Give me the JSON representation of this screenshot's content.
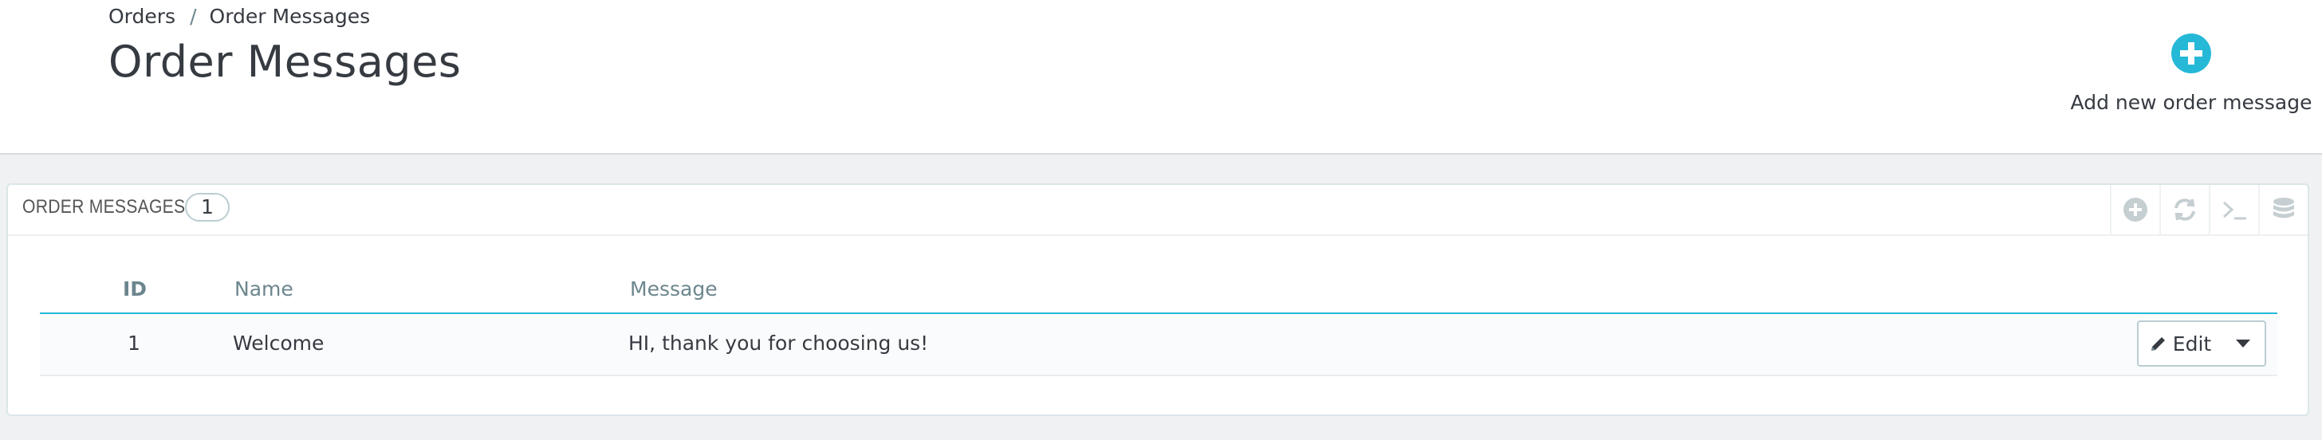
{
  "breadcrumb": {
    "parent": "Orders",
    "separator": "/",
    "current": "Order Messages"
  },
  "page": {
    "title": "Order Messages"
  },
  "toolbar": {
    "add_new_label": "Add new order message"
  },
  "panel": {
    "title": "Order messages",
    "count": "1",
    "tools": [
      "add-icon",
      "refresh-icon",
      "sql-query-icon",
      "database-export-icon"
    ]
  },
  "table": {
    "columns": {
      "id": "ID",
      "name": "Name",
      "message": "Message"
    },
    "rows": [
      {
        "id": "1",
        "name": "Welcome",
        "message": "HI, thank you for choosing us!",
        "action": "Edit"
      }
    ]
  },
  "colors": {
    "accent": "#25b9d7",
    "text": "#363a41",
    "background": "#eff1f2"
  }
}
